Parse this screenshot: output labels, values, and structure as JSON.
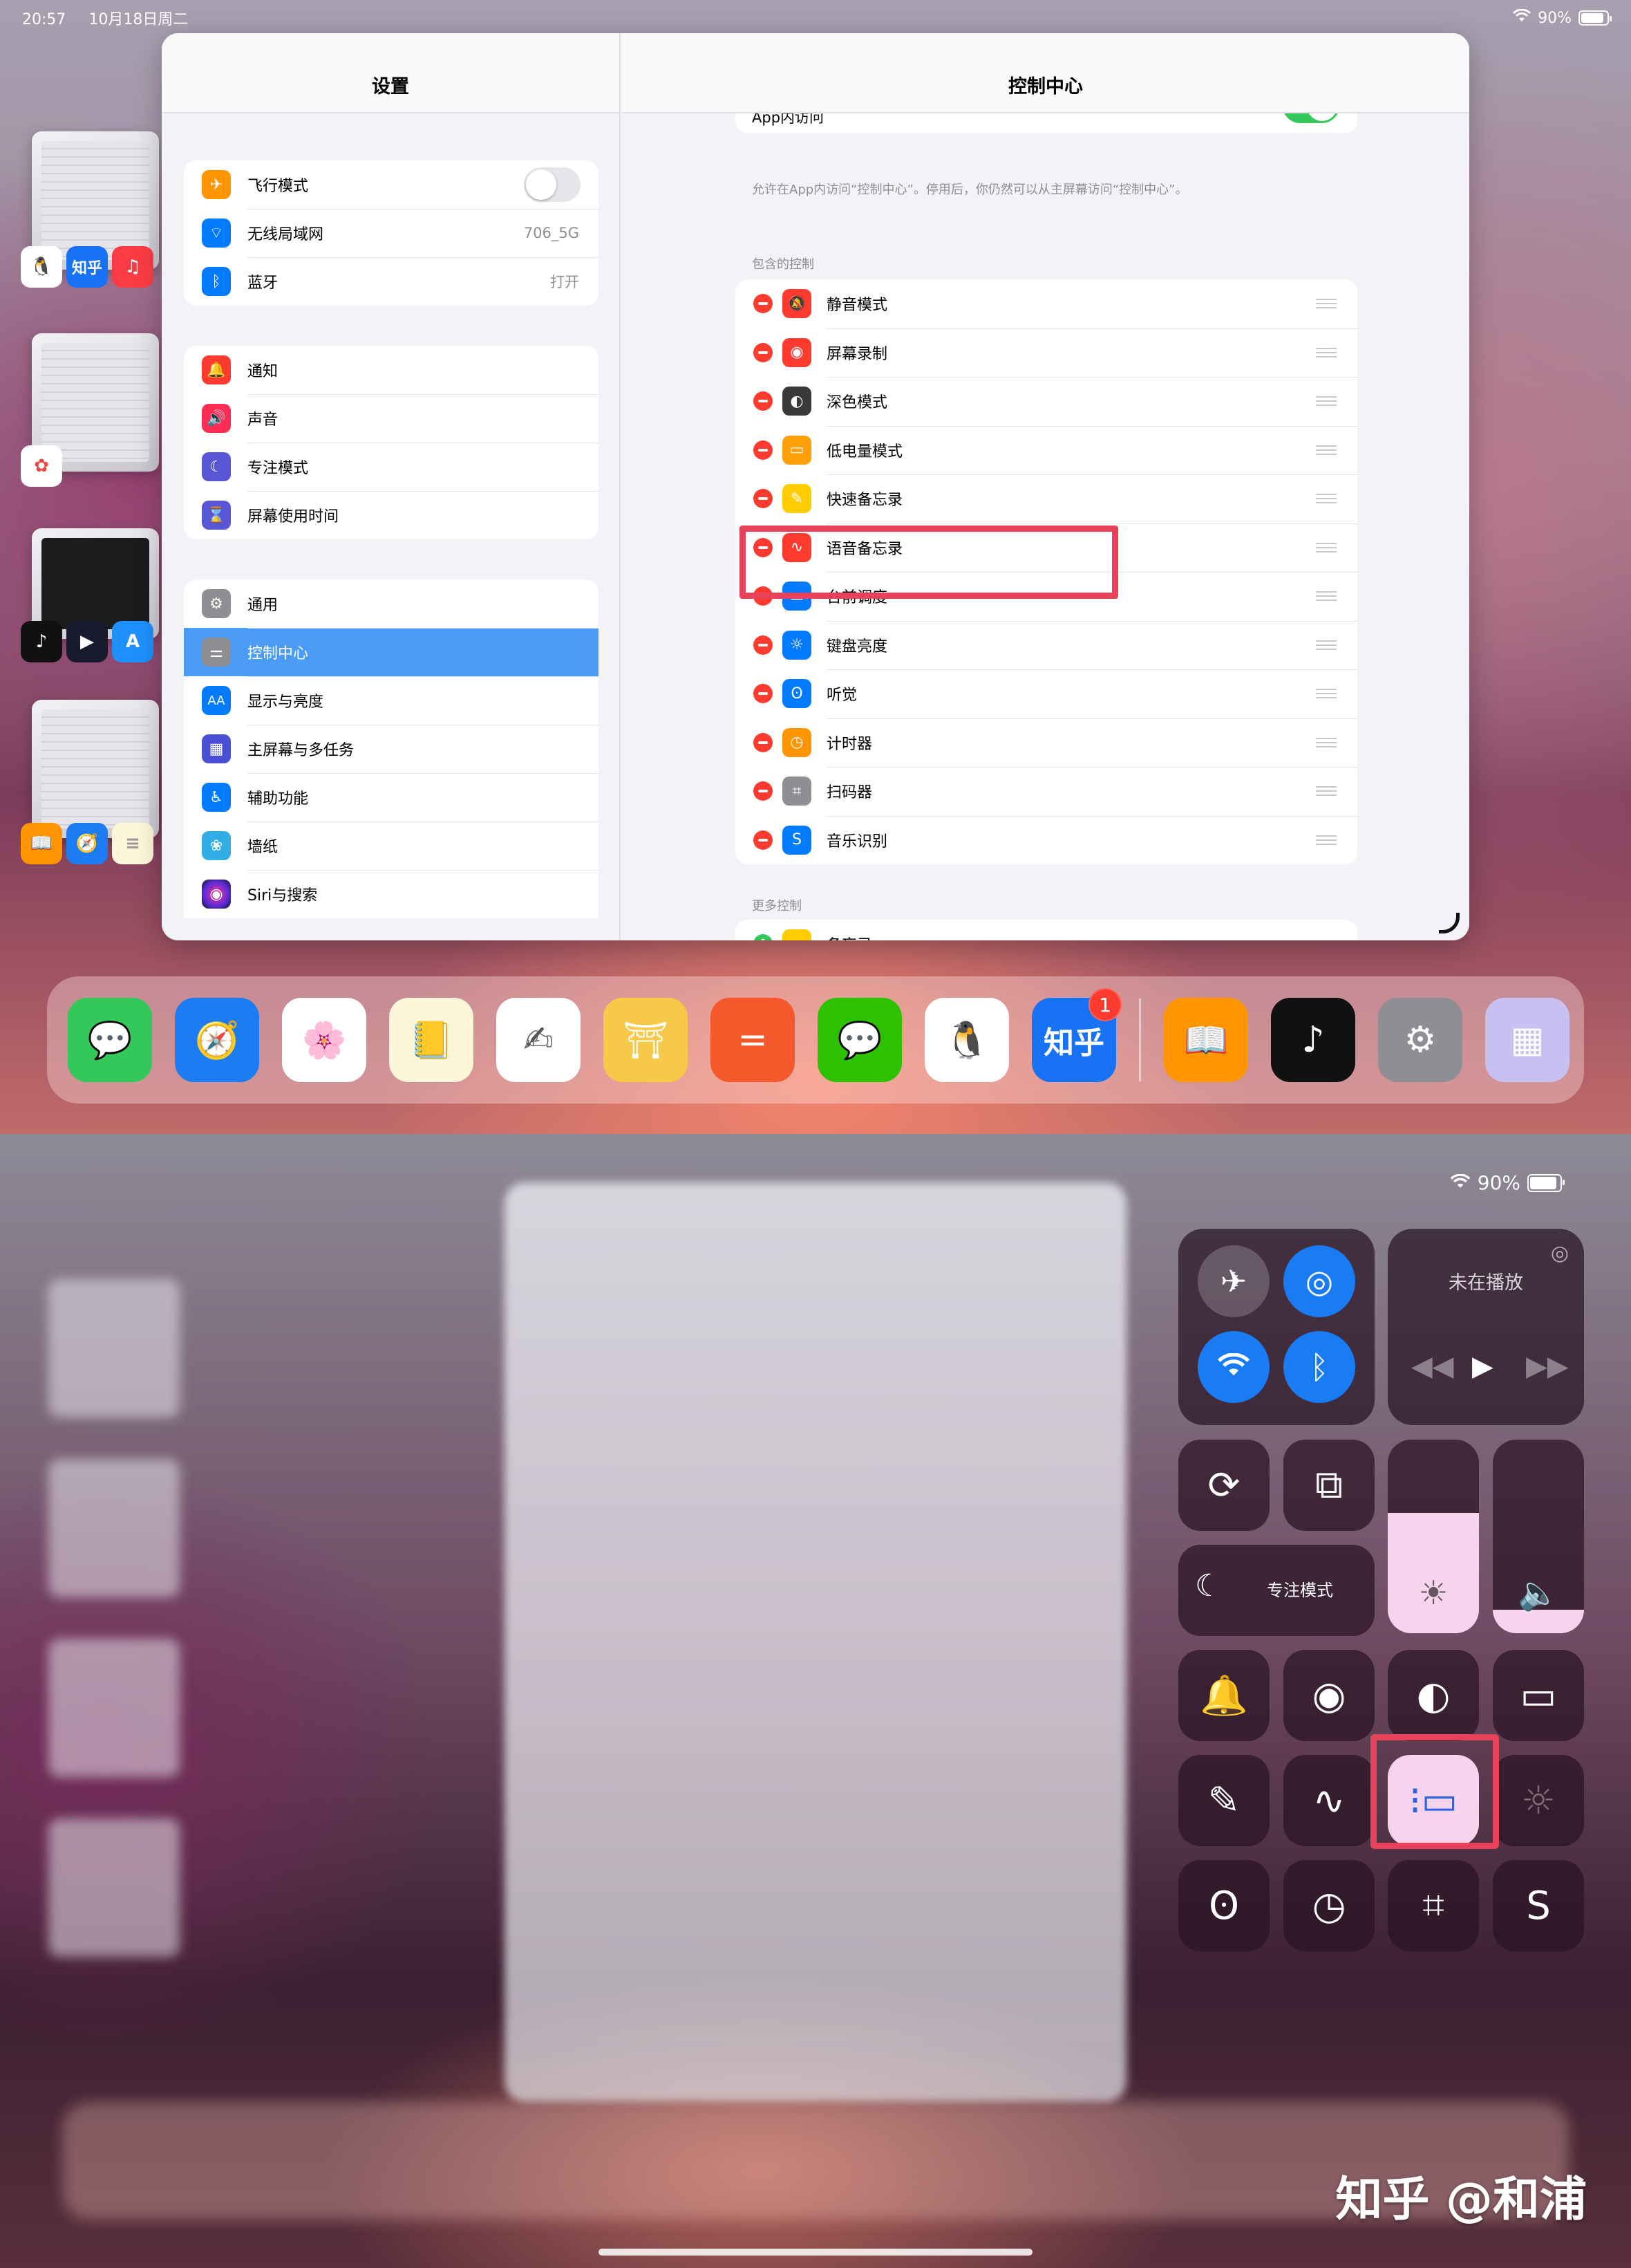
{
  "status_bar": {
    "time": "20:57",
    "date": "10月18日周二",
    "battery": "90%",
    "battery_level": 0.9
  },
  "switcher": {
    "thumb_icons": [
      [
        "QQ",
        "知乎",
        "音乐"
      ],
      [
        "照片"
      ],
      [
        "抖音",
        "Infuse",
        "App Store"
      ],
      [
        "图书",
        "Safari",
        "备忘录"
      ]
    ]
  },
  "settings": {
    "title": "设置",
    "groups": [
      [
        {
          "label": "飞行模式",
          "icon": "airplane-icon",
          "color": "#ff9500",
          "toggle": false
        },
        {
          "label": "无线局域网",
          "icon": "wifi-icon",
          "color": "#007aff",
          "value": "706_5G"
        },
        {
          "label": "蓝牙",
          "icon": "bluetooth-icon",
          "color": "#007aff",
          "value": "打开"
        }
      ],
      [
        {
          "label": "通知",
          "icon": "bell-icon",
          "color": "#ff3b30"
        },
        {
          "label": "声音",
          "icon": "speaker-icon",
          "color": "#ff2d55"
        },
        {
          "label": "专注模式",
          "icon": "moon-icon",
          "color": "#5856d6"
        },
        {
          "label": "屏幕使用时间",
          "icon": "hourglass-icon",
          "color": "#5856d6"
        }
      ],
      [
        {
          "label": "通用",
          "icon": "gear-icon",
          "color": "#8e8e93"
        },
        {
          "label": "控制中心",
          "icon": "switches-icon",
          "color": "#8e8e93",
          "selected": true
        },
        {
          "label": "显示与亮度",
          "icon": "aa-icon",
          "color": "#007aff"
        },
        {
          "label": "主屏幕与多任务",
          "icon": "grid-icon",
          "color": "#4a4fd4"
        },
        {
          "label": "辅助功能",
          "icon": "accessibility-icon",
          "color": "#007aff"
        },
        {
          "label": "墙纸",
          "icon": "flower-icon",
          "color": "#32ade6"
        },
        {
          "label": "Siri与搜索",
          "icon": "siri-icon",
          "color": "#222222"
        }
      ]
    ]
  },
  "control_center_settings": {
    "title": "控制中心",
    "app_access_label": "App内访问",
    "app_access_on": true,
    "hint": "允许在App内访问“控制中心”。停用后，你仍然可以从主屏幕访问“控制中心”。",
    "included_label": "包含的控制",
    "included": [
      {
        "label": "静音模式",
        "icon": "bell-slash-icon",
        "color": "#ff3b30"
      },
      {
        "label": "屏幕录制",
        "icon": "record-icon",
        "color": "#ff3b30"
      },
      {
        "label": "深色模式",
        "icon": "dark-mode-icon",
        "color": "#3a3a3c"
      },
      {
        "label": "低电量模式",
        "icon": "battery-icon",
        "color": "#ff9f0a"
      },
      {
        "label": "快速备忘录",
        "icon": "quick-note-icon",
        "color": "#ffcc00"
      },
      {
        "label": "语音备忘录",
        "icon": "waveform-icon",
        "color": "#ff3b30"
      },
      {
        "label": "台前调度",
        "icon": "stage-manager-icon",
        "color": "#007aff"
      },
      {
        "label": "键盘亮度",
        "icon": "keyboard-brightness-icon",
        "color": "#007aff"
      },
      {
        "label": "听觉",
        "icon": "ear-icon",
        "color": "#007aff"
      },
      {
        "label": "计时器",
        "icon": "timer-icon",
        "color": "#ff9500"
      },
      {
        "label": "扫码器",
        "icon": "qr-icon",
        "color": "#8e8e93"
      },
      {
        "label": "音乐识别",
        "icon": "shazam-icon",
        "color": "#007aff"
      }
    ],
    "more_label": "更多控制",
    "more": [
      {
        "label": "备忘录",
        "icon": "notes-icon",
        "color": "#ffcc00"
      }
    ]
  },
  "dock": {
    "apps": [
      {
        "name": "信息",
        "icon": "messages-icon",
        "color": "#34c759",
        "glyph": "💬"
      },
      {
        "name": "Safari",
        "icon": "safari-icon",
        "color": "#1e7cf2",
        "glyph": "🧭"
      },
      {
        "name": "照片",
        "icon": "photos-icon",
        "color": "#ffffff",
        "glyph": "🌸"
      },
      {
        "name": "备忘录",
        "icon": "notes-icon",
        "color": "#fdf6d8",
        "glyph": "📒"
      },
      {
        "name": "无边记",
        "icon": "freeform-icon",
        "color": "#ffffff",
        "glyph": "✍"
      },
      {
        "name": "App",
        "icon": "temple-icon",
        "color": "#f7c948",
        "glyph": "⛩"
      },
      {
        "name": "App",
        "icon": "equals-icon",
        "color": "#f5582a",
        "glyph": "="
      },
      {
        "name": "微信",
        "icon": "wechat-icon",
        "color": "#2dc100",
        "glyph": "💬"
      },
      {
        "name": "QQ",
        "icon": "qq-icon",
        "color": "#ffffff",
        "glyph": "🐧"
      },
      {
        "name": "知乎",
        "icon": "zhihu-icon",
        "color": "#1772f6",
        "label": "知乎",
        "badge": "1"
      }
    ],
    "recent": [
      {
        "name": "图书",
        "icon": "books-icon",
        "color": "#ff9500",
        "glyph": "📖"
      },
      {
        "name": "抖音",
        "icon": "tiktok-icon",
        "color": "#111111",
        "glyph": "♪"
      },
      {
        "name": "设置",
        "icon": "settings-icon",
        "color": "#8e8e93",
        "glyph": "⚙"
      },
      {
        "name": "App库",
        "icon": "app-library-icon",
        "color": "#c8c0f0",
        "glyph": "▦"
      }
    ]
  },
  "control_center": {
    "battery": "90%",
    "now_playing": "未在播放",
    "focus_label": "专注模式",
    "brightness_level": 0.62,
    "volume_level": 0.12
  },
  "watermark": "知乎 @和浦"
}
